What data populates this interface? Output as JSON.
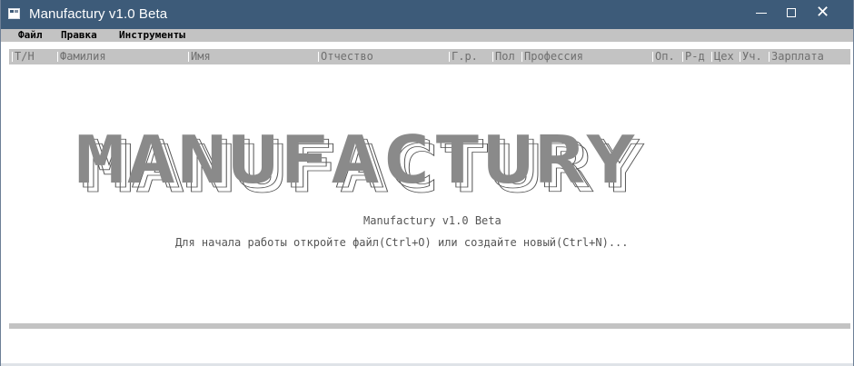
{
  "window": {
    "title": "Manufactury v1.0 Beta",
    "icons": {
      "app": "app-window-icon",
      "minimize": "minimize-icon",
      "maximize": "maximize-icon",
      "close": "close-icon"
    }
  },
  "menu": {
    "items": [
      {
        "label": "Файл"
      },
      {
        "label": "Правка"
      },
      {
        "label": "Инструменты"
      }
    ]
  },
  "table": {
    "columns": [
      {
        "label": "Т/Н"
      },
      {
        "label": "Фамилия"
      },
      {
        "label": "Имя"
      },
      {
        "label": "Отчество"
      },
      {
        "label": "Г.р."
      },
      {
        "label": "Пол"
      },
      {
        "label": "Профессия"
      },
      {
        "label": "Оп."
      },
      {
        "label": "Р-д"
      },
      {
        "label": "Цех"
      },
      {
        "label": "Уч."
      },
      {
        "label": "Зарплата"
      }
    ]
  },
  "splash": {
    "logo_text": "MANUFACTURY",
    "subtitle": "Manufactury v1.0 Beta",
    "hint": "Для начала работы откройте файл(Ctrl+O) или создайте новый(Ctrl+N)..."
  },
  "colors": {
    "titlebar": "#3d5b79",
    "panel": "#c3c3c3",
    "header_text": "#6f6f6f",
    "logo": "#8a8a8a"
  }
}
